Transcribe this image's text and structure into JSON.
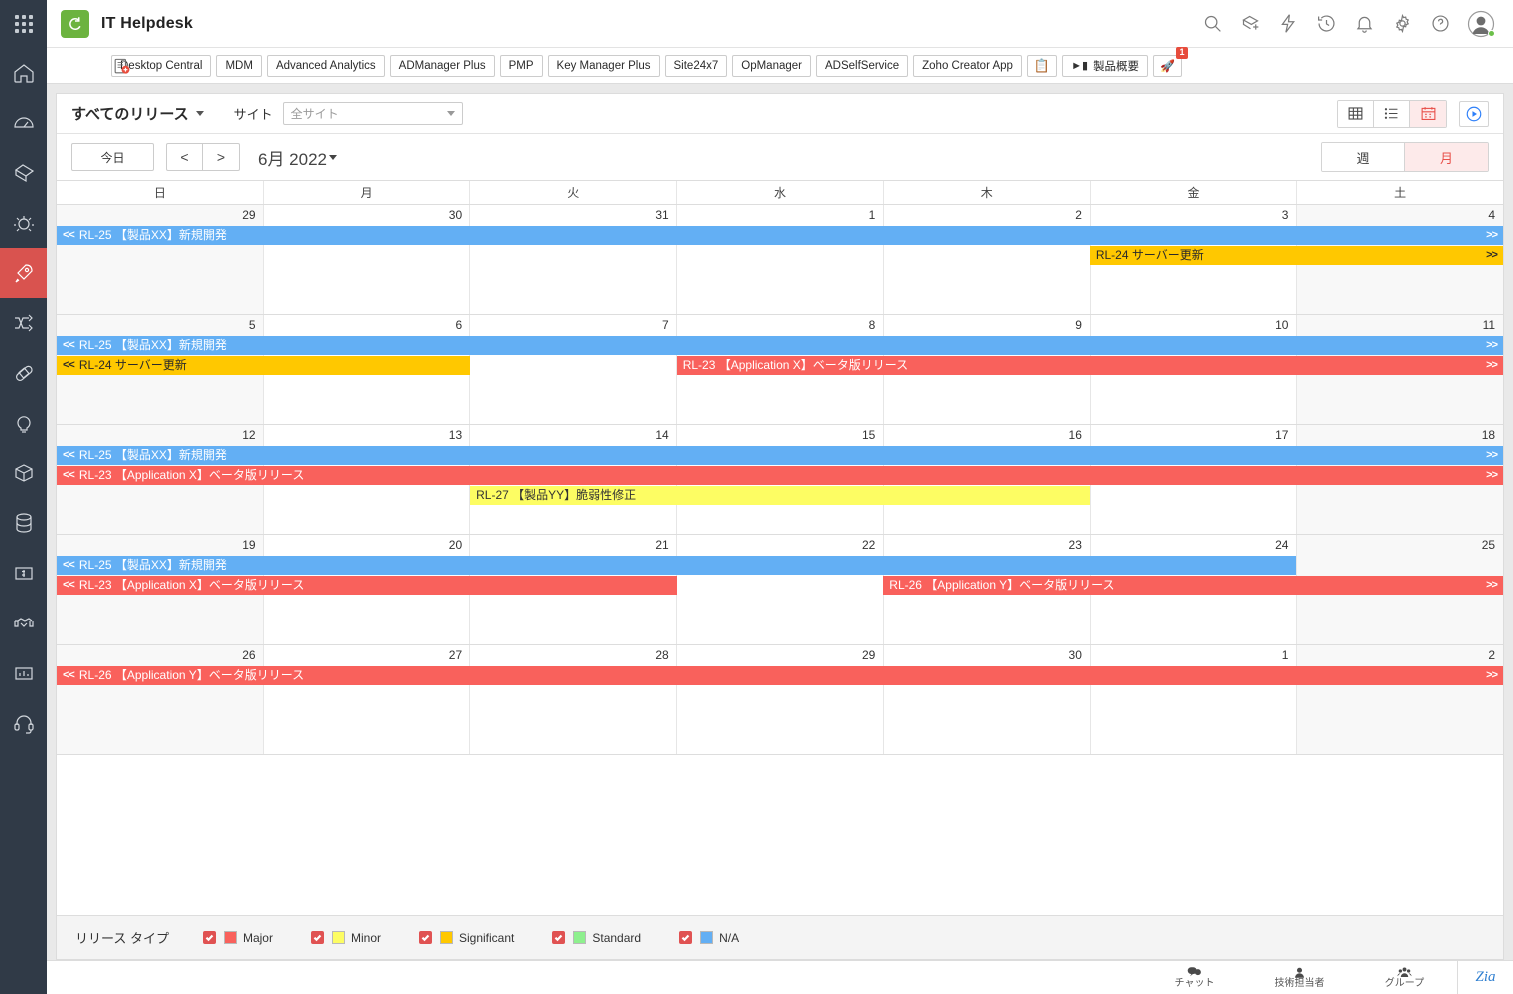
{
  "sidebar": {
    "apps_icon": "grid-apps-icon",
    "items": [
      {
        "name": "home",
        "icon": "home-icon"
      },
      {
        "name": "dashboard",
        "icon": "gauge-icon"
      },
      {
        "name": "tickets",
        "icon": "ticket-icon"
      },
      {
        "name": "problems",
        "icon": "bug-icon"
      },
      {
        "name": "changes",
        "icon": "rocket-icon",
        "active": true
      },
      {
        "name": "releases",
        "icon": "shuffle-icon"
      },
      {
        "name": "patches",
        "icon": "bandaid-icon"
      },
      {
        "name": "solutions",
        "icon": "bulb-icon"
      },
      {
        "name": "assets",
        "icon": "box-icon"
      },
      {
        "name": "cmdb",
        "icon": "database-icon"
      },
      {
        "name": "purchase",
        "icon": "dollar-icon"
      },
      {
        "name": "contracts",
        "icon": "handshake-icon"
      },
      {
        "name": "reports",
        "icon": "chart-icon"
      },
      {
        "name": "support",
        "icon": "headset-icon"
      }
    ]
  },
  "header": {
    "title": "IT Helpdesk",
    "logo_icon": "servicedesk-logo",
    "icons": [
      {
        "name": "search-icon"
      },
      {
        "name": "add-ticket-icon"
      },
      {
        "name": "quick-actions-icon"
      },
      {
        "name": "history-icon"
      },
      {
        "name": "notifications-icon"
      },
      {
        "name": "settings-gear-icon"
      },
      {
        "name": "help-icon"
      }
    ],
    "avatar": "user-avatar",
    "status": "online"
  },
  "tabstrip": {
    "add_icon": "add-tab-icon",
    "tabs": [
      {
        "label": "Desktop Central"
      },
      {
        "label": "MDM"
      },
      {
        "label": "Advanced Analytics"
      },
      {
        "label": "ADManager Plus"
      },
      {
        "label": "PMP"
      },
      {
        "label": "Key Manager Plus"
      },
      {
        "label": "Site24x7"
      },
      {
        "label": "OpManager"
      },
      {
        "label": "ADSelfService"
      },
      {
        "label": "Zoho Creator App"
      }
    ],
    "clipboard_icon": "clipboard-icon",
    "video_tab": {
      "label": "製品概要",
      "icon": "video-camera-icon"
    },
    "rocket_tab": {
      "icon": "rocket-icon",
      "badge": "1"
    }
  },
  "filterbar": {
    "release_filter": "すべてのリリース",
    "site_label": "サイト",
    "site_placeholder": "全サイト",
    "views": [
      {
        "name": "grid-view",
        "icon": "grid-icon",
        "active": false
      },
      {
        "name": "list-view",
        "icon": "list-icon",
        "active": false
      },
      {
        "name": "calendar-view",
        "icon": "calendar-icon",
        "active": true
      }
    ],
    "play_button": "timeline-play-icon"
  },
  "navbar": {
    "today": "今日",
    "prev": "<",
    "next": ">",
    "period": "6月 2022",
    "week": "週",
    "month": "月",
    "month_active": true
  },
  "calendar": {
    "weekday_headers": [
      "日",
      "月",
      "火",
      "水",
      "木",
      "金",
      "土"
    ],
    "weeks": [
      {
        "days": [
          "29",
          "30",
          "31",
          "1",
          "2",
          "3",
          "4"
        ]
      },
      {
        "days": [
          "5",
          "6",
          "7",
          "8",
          "9",
          "10",
          "11"
        ]
      },
      {
        "days": [
          "12",
          "13",
          "14",
          "15",
          "16",
          "17",
          "18"
        ]
      },
      {
        "days": [
          "19",
          "20",
          "21",
          "22",
          "23",
          "24",
          "25"
        ]
      },
      {
        "days": [
          "26",
          "27",
          "28",
          "29",
          "30",
          "1",
          "2"
        ]
      }
    ],
    "events": [
      {
        "week": 0,
        "row": 0,
        "start": 0,
        "end": 7,
        "type": "na",
        "label": "RL-25 【製品XX】新規開発",
        "cont_left": true,
        "cont_right": true
      },
      {
        "week": 0,
        "row": 1,
        "start": 5,
        "end": 7,
        "type": "significant",
        "label": "RL-24 サーバー更新",
        "cont_left": false,
        "cont_right": true
      },
      {
        "week": 1,
        "row": 0,
        "start": 0,
        "end": 7,
        "type": "na",
        "label": "RL-25 【製品XX】新規開発",
        "cont_left": true,
        "cont_right": true
      },
      {
        "week": 1,
        "row": 1,
        "start": 0,
        "end": 2,
        "type": "significant",
        "label": "RL-24 サーバー更新",
        "cont_left": true,
        "cont_right": false
      },
      {
        "week": 1,
        "row": 1,
        "start": 3,
        "end": 7,
        "type": "major",
        "label": "RL-23 【Application X】ベータ版リリース",
        "cont_left": false,
        "cont_right": true
      },
      {
        "week": 2,
        "row": 0,
        "start": 0,
        "end": 7,
        "type": "na",
        "label": "RL-25 【製品XX】新規開発",
        "cont_left": true,
        "cont_right": true
      },
      {
        "week": 2,
        "row": 1,
        "start": 0,
        "end": 7,
        "type": "major",
        "label": "RL-23 【Application X】ベータ版リリース",
        "cont_left": true,
        "cont_right": true
      },
      {
        "week": 2,
        "row": 2,
        "start": 2,
        "end": 5,
        "type": "minor",
        "label": "RL-27 【製品YY】脆弱性修正",
        "cont_left": false,
        "cont_right": false
      },
      {
        "week": 3,
        "row": 0,
        "start": 0,
        "end": 6,
        "type": "na",
        "label": "RL-25 【製品XX】新規開発",
        "cont_left": true,
        "cont_right": false
      },
      {
        "week": 3,
        "row": 1,
        "start": 0,
        "end": 3,
        "type": "major",
        "label": "RL-23 【Application X】ベータ版リリース",
        "cont_left": true,
        "cont_right": false
      },
      {
        "week": 3,
        "row": 1,
        "start": 4,
        "end": 7,
        "type": "major",
        "label": "RL-26 【Application Y】ベータ版リリース",
        "cont_left": false,
        "cont_right": true
      },
      {
        "week": 4,
        "row": 0,
        "start": 0,
        "end": 7,
        "type": "major",
        "label": "RL-26 【Application Y】ベータ版リリース",
        "cont_left": true,
        "cont_right": true
      }
    ],
    "arrow_left": "<<",
    "arrow_right": ">>"
  },
  "legend": {
    "title": "リリース タイプ",
    "items": [
      {
        "label": "Major",
        "color": "#f9615c",
        "checked": true
      },
      {
        "label": "Minor",
        "color": "#fdfd63",
        "checked": true
      },
      {
        "label": "Significant",
        "color": "#ffc800",
        "checked": true
      },
      {
        "label": "Standard",
        "color": "#8ef08e",
        "checked": true
      },
      {
        "label": "N/A",
        "color": "#63aff4",
        "checked": true
      }
    ]
  },
  "bottombar": {
    "items": [
      {
        "label": "チャット",
        "icon": "chat-icon"
      },
      {
        "label": "技術担当者",
        "icon": "person-icon"
      },
      {
        "label": "グループ",
        "icon": "group-icon"
      }
    ],
    "zia": "Zia"
  }
}
